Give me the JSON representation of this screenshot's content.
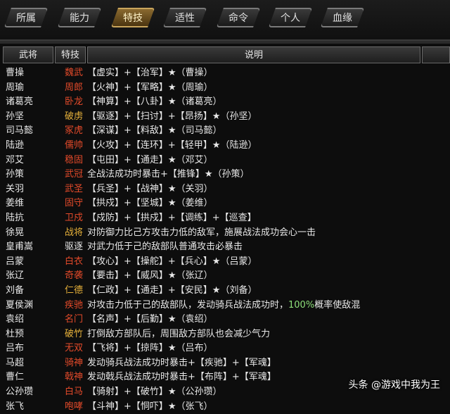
{
  "tabs": [
    {
      "label": "所属",
      "active": false
    },
    {
      "label": "能力",
      "active": false
    },
    {
      "label": "特技",
      "active": true
    },
    {
      "label": "适性",
      "active": false
    },
    {
      "label": "命令",
      "active": false
    },
    {
      "label": "个人",
      "active": false
    },
    {
      "label": "血缘",
      "active": false
    }
  ],
  "columns": {
    "general": "武将",
    "skill": "特技",
    "desc": "说明"
  },
  "rows": [
    {
      "general": "曹操",
      "skill": "魏武",
      "skill_color": "red",
      "desc": "【虚实】+【治军】★（曹操）"
    },
    {
      "general": "周瑜",
      "skill": "周郎",
      "skill_color": "red",
      "desc": "【火神】+【军略】★（周瑜）"
    },
    {
      "general": "诸葛亮",
      "skill": "卧龙",
      "skill_color": "red",
      "desc": "【神算】+【八卦】★（诸葛亮）"
    },
    {
      "general": "孙坚",
      "skill": "破虏",
      "skill_color": "yellow",
      "desc": "【驱逐】+【扫讨】+【昂扬】★（孙坚）"
    },
    {
      "general": "司马懿",
      "skill": "冢虎",
      "skill_color": "red",
      "desc": "【深谋】+【料敌】★（司马懿）"
    },
    {
      "general": "陆逊",
      "skill": "儒帅",
      "skill_color": "red",
      "desc": "【火攻】+【连环】+【轻甲】★（陆逊）"
    },
    {
      "general": "邓艾",
      "skill": "稳固",
      "skill_color": "red",
      "desc": "【屯田】+【通走】★（邓艾）"
    },
    {
      "general": "孙策",
      "skill": "武冠",
      "skill_color": "red",
      "desc": "全战法成功时暴击+【推锋】★（孙策）"
    },
    {
      "general": "关羽",
      "skill": "武圣",
      "skill_color": "red",
      "desc": "【兵圣】+【战神】★（关羽）"
    },
    {
      "general": "姜维",
      "skill": "固守",
      "skill_color": "red",
      "desc": "【拱戍】+【坚城】★（姜维）"
    },
    {
      "general": "陆抗",
      "skill": "卫戍",
      "skill_color": "red",
      "desc": "【戍防】+【拱戍】+【调练】+【巡查】"
    },
    {
      "general": "徐晃",
      "skill": "战将",
      "skill_color": "yellow",
      "desc": "对防御力比己方攻击力低的敌军，施展战法成功会心一击"
    },
    {
      "general": "皇甫嵩",
      "skill": "驱逐",
      "skill_color": "white",
      "desc": "对武力低于己的敌部队普通攻击必暴击"
    },
    {
      "general": "吕蒙",
      "skill": "白衣",
      "skill_color": "red",
      "desc": "【攻心】+【操舵】+【兵心】★（吕蒙）"
    },
    {
      "general": "张辽",
      "skill": "奇袭",
      "skill_color": "red",
      "desc": "【要击】+【威风】★（张辽）"
    },
    {
      "general": "刘备",
      "skill": "仁德",
      "skill_color": "yellow",
      "desc": "【仁政】+【通走】+【安民】★（刘备）"
    },
    {
      "general": "夏侯渊",
      "skill": "疾驰",
      "skill_color": "red",
      "desc": "对攻击力低于己的敌部队，发动骑兵战法成功时，",
      "highlight": "100%",
      "desc_tail": "概率使敌混"
    },
    {
      "general": "袁绍",
      "skill": "名门",
      "skill_color": "red",
      "desc": "【名声】+【后勤】★（袁绍）"
    },
    {
      "general": "杜预",
      "skill": "破竹",
      "skill_color": "yellow",
      "desc": "打倒敌方部队后，周围敌方部队也会减少气力"
    },
    {
      "general": "吕布",
      "skill": "无双",
      "skill_color": "red",
      "desc": "【飞将】+【掠阵】★（吕布）"
    },
    {
      "general": "马超",
      "skill": "骑神",
      "skill_color": "red",
      "desc": "发动骑兵战法成功时暴击+【疾驰】+【军魂】"
    },
    {
      "general": "曹仁",
      "skill": "戟神",
      "skill_color": "red",
      "desc": "发动戟兵战法成功时暴击+【布阵】+【军魂】"
    },
    {
      "general": "公孙瓒",
      "skill": "白马",
      "skill_color": "red",
      "desc": "【骑射】+【破竹】★（公孙瓒）"
    },
    {
      "general": "张飞",
      "skill": "咆哮",
      "skill_color": "red",
      "desc": "【斗神】+【恫吓】★（张飞）"
    }
  ],
  "watermark": "头条 @游戏中我为王"
}
